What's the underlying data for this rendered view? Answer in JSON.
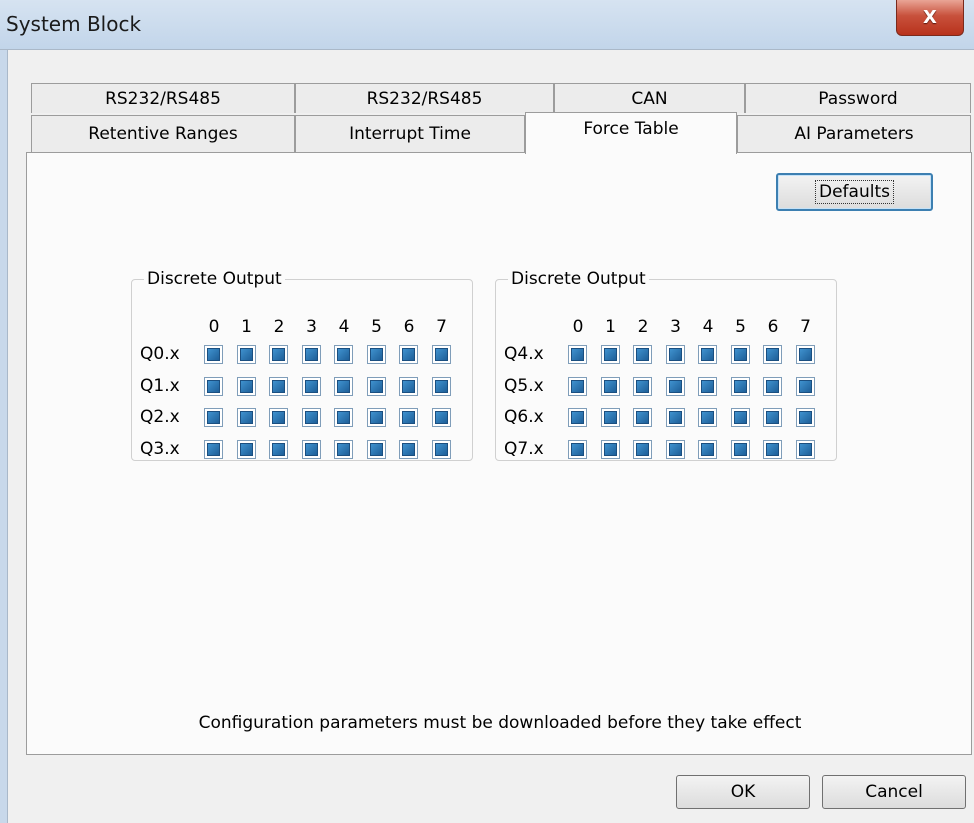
{
  "window": {
    "title": "System Block",
    "close_symbol": "X"
  },
  "tabs_row1": [
    "RS232/RS485",
    "RS232/RS485",
    "CAN",
    "Password"
  ],
  "tabs_row2": [
    "Retentive Ranges",
    "Interrupt Time",
    "Force Table",
    "AI Parameters"
  ],
  "active_tab": "Force Table",
  "defaults_label": "Defaults",
  "groups": [
    {
      "label": "Discrete Output",
      "columns": [
        "0",
        "1",
        "2",
        "3",
        "4",
        "5",
        "6",
        "7"
      ],
      "rows": [
        "Q0.x",
        "Q1.x",
        "Q2.x",
        "Q3.x"
      ]
    },
    {
      "label": "Discrete Output",
      "columns": [
        "0",
        "1",
        "2",
        "3",
        "4",
        "5",
        "6",
        "7"
      ],
      "rows": [
        "Q4.x",
        "Q5.x",
        "Q6.x",
        "Q7.x"
      ]
    }
  ],
  "note": "Configuration parameters must be downloaded before they take effect",
  "buttons": {
    "ok": "OK",
    "cancel": "Cancel"
  },
  "colors": {
    "cell_fill": "#2f7bbd",
    "cell_border": "#7f9db9",
    "titlebar": "#c9dbee",
    "close": "#c8513c"
  }
}
